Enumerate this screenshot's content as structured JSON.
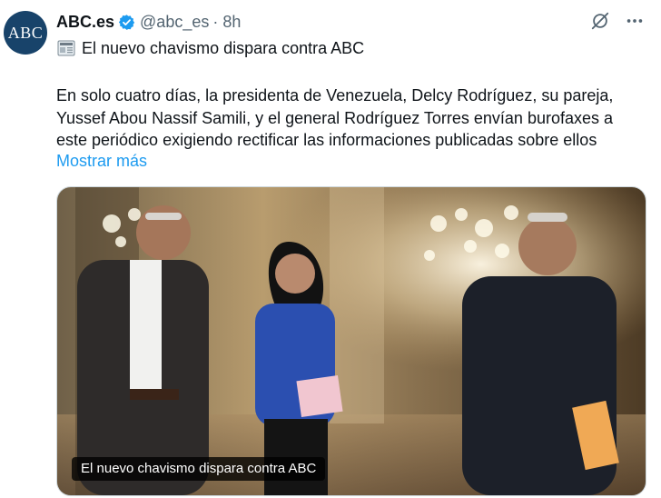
{
  "account": {
    "avatar_text": "ABC",
    "display_name": "ABC.es",
    "handle": "@abc_es",
    "separator": "·",
    "time": "8h"
  },
  "icons": {
    "verified": "verified-badge-icon",
    "grok": "grok-icon",
    "more": "more-icon",
    "newspaper": "newspaper-emoji-icon"
  },
  "tweet": {
    "headline": "El nuevo chavismo dispara contra ABC",
    "body": " En solo cuatro días, la presidenta de Venezuela, Delcy Rodríguez, su pareja,\nYussef Abou Nassif Samili, y el general Rodríguez Torres envían burofaxes a\neste periódico exigiendo rectificar las informaciones publicadas sobre ellos",
    "show_more": "Mostrar más"
  },
  "media": {
    "caption": "El nuevo chavismo dispara contra ABC"
  },
  "colors": {
    "accent": "#1d9bf0",
    "avatar_bg": "#18436a",
    "text": "#0f1419",
    "muted": "#536471"
  }
}
